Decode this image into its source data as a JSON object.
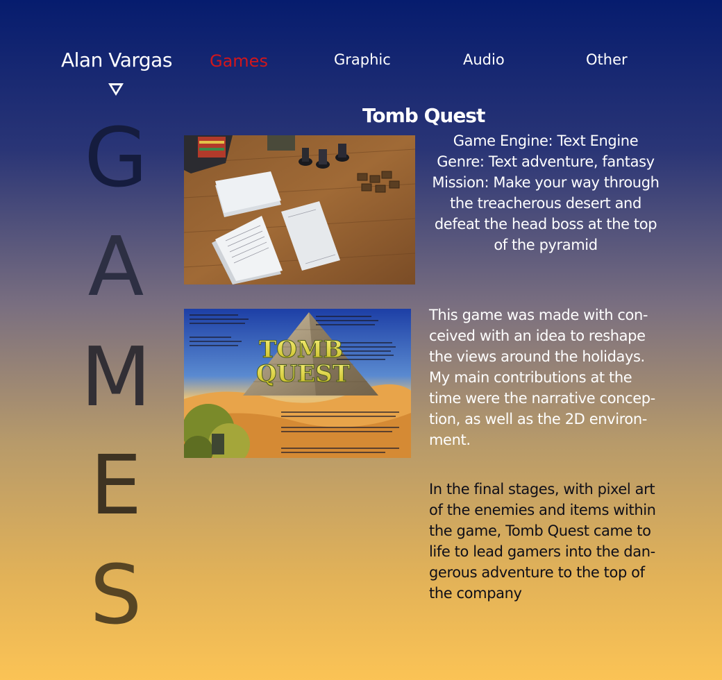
{
  "header": {
    "brand": "Alan Vargas",
    "nav": [
      {
        "label": "Games",
        "active": true
      },
      {
        "label": "Graphic",
        "active": false
      },
      {
        "label": "Audio",
        "active": false
      },
      {
        "label": "Other",
        "active": false
      }
    ]
  },
  "side_title": {
    "letters": [
      "G",
      "A",
      "M",
      "E",
      "S"
    ]
  },
  "project": {
    "title": "Tomb Quest",
    "info_lines": [
      "Game Engine: Text Engine",
      "Genre: Text adventure, fantasy",
      "Mission: Make your way through",
      "the treacherous desert and",
      "defeat the head boss at the top",
      "of the pyramid"
    ],
    "description_1_lines": [
      "This game  was made with con-",
      "ceived with an idea to reshape",
      "the views around the holidays.",
      "My main contributions at the",
      "time were the narrative concep-",
      "tion, as well as the 2D environ-",
      "ment."
    ],
    "description_2_lines": [
      "In the final stages, with pixel art",
      "of the enemies and items within",
      "the game, Tomb Quest came to",
      "life to lead gamers into the dan-",
      "gerous adventure to the top of",
      "the company"
    ],
    "poster": {
      "logo_line1": "TOMB",
      "logo_line2": "QUEST"
    }
  },
  "colors": {
    "active_nav": "#d1161c",
    "gradient_top": "#061c6e",
    "gradient_bottom": "#fbc355"
  }
}
